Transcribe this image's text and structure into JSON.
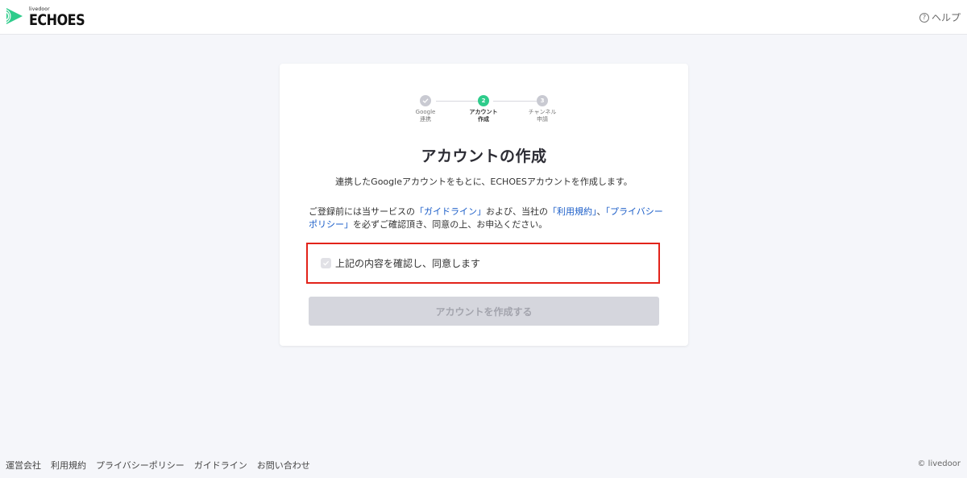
{
  "header": {
    "logo_small": "livedoor",
    "logo_word": "ECHOES",
    "logo_color": "#2ecc8b",
    "help_label": "ヘルプ",
    "help_icon": "question-circle-icon"
  },
  "steps": [
    {
      "number": "",
      "label_line1": "Google",
      "label_line2": "連携",
      "state": "done"
    },
    {
      "number": "2",
      "label_line1": "アカウント",
      "label_line2": "作成",
      "state": "active"
    },
    {
      "number": "3",
      "label_line1": "チャンネル",
      "label_line2": "申請",
      "state": "pending"
    }
  ],
  "colors": {
    "step_done": "#c9cad2",
    "step_active": "#2ecc8b",
    "step_pending": "#c9cad2",
    "link": "#1a5dc8",
    "highlight_border": "#e2231a",
    "button_disabled_bg": "#d5d6dd"
  },
  "main": {
    "title": "アカウントの作成",
    "subtitle": "連携したGoogleアカウントをもとに、ECHOESアカウントを作成します。",
    "notice": {
      "text1": "ご登録前には当サービスの",
      "link_guideline": "「ガイドライン」",
      "text2": "および、当社の",
      "link_terms": "「利用規約」",
      "text3": "、",
      "link_privacy": "「プライバシーポリシー」",
      "text4": "を必ずご確認頂き、同意の上、お申込ください。"
    },
    "agree_label": "上記の内容を確認し、同意します",
    "submit_label": "アカウントを作成する"
  },
  "footer": {
    "links": [
      "運営会社",
      "利用規約",
      "プライバシーポリシー",
      "ガイドライン",
      "お問い合わせ"
    ],
    "copyright": "© livedoor"
  }
}
